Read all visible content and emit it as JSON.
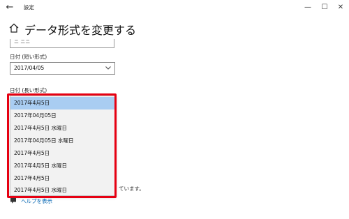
{
  "window": {
    "app_title": "設定",
    "back_glyph": "←",
    "minimize_glyph": "—",
    "maximize_glyph": "☐",
    "close_glyph": "✕"
  },
  "page": {
    "title": "データ形式を変更する",
    "previous_field_value": "ニ ニニ"
  },
  "short_date": {
    "label": "日付 (短い形式)",
    "value": "2017/04/05"
  },
  "long_date": {
    "label": "日付 (長い形式)",
    "options": [
      "2017年4月5日",
      "2017年04月05日",
      "2017年4月5日 水曜日",
      "2017年04月05日 水曜日",
      "2017年4月5日",
      "2017年4月5日 水曜日",
      "2017年4月5日",
      "2017年4月5日 水曜日"
    ],
    "selected_index": 0
  },
  "partial_text": "ています。",
  "help": {
    "link_label": "ヘルプを表示"
  },
  "colors": {
    "highlight_border": "#e60012",
    "selected_option_bg": "#a9cdf2",
    "link": "#0063b1"
  }
}
